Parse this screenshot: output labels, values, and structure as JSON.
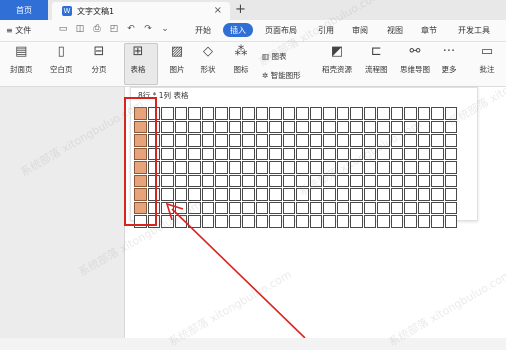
{
  "tabbar": {
    "home": "首页",
    "doc_icon": "W",
    "doc_title": "文字文稿1",
    "close": "×",
    "new_tab": "+"
  },
  "ribbon": {
    "menu_label": "文件",
    "tabs": [
      "开始",
      "插入",
      "页面布局",
      "引用",
      "审阅",
      "视图",
      "章节",
      "开发工具"
    ],
    "active_tab": "插入"
  },
  "toolbar": {
    "cover": "封面页",
    "blank": "空白页",
    "page_break": "分页",
    "table": "表格",
    "picture": "图片",
    "shape": "形状",
    "icon": "图标",
    "chart": "图表",
    "smart": "智能图形",
    "shell": "稻壳资源",
    "flow": "流程图",
    "mind": "思维导图",
    "more": "更多",
    "comment": "批注"
  },
  "table_picker": {
    "label": "8行 * 1列 表格",
    "rows": 9,
    "cols": 24,
    "selected_rows": 8,
    "selected_cols": 1
  },
  "watermark": "系统部落 xitongbuluo.com",
  "colors": {
    "accent": "#2f6fd6",
    "highlight": "#d8231f",
    "selected_cell": "#e8a37a"
  }
}
